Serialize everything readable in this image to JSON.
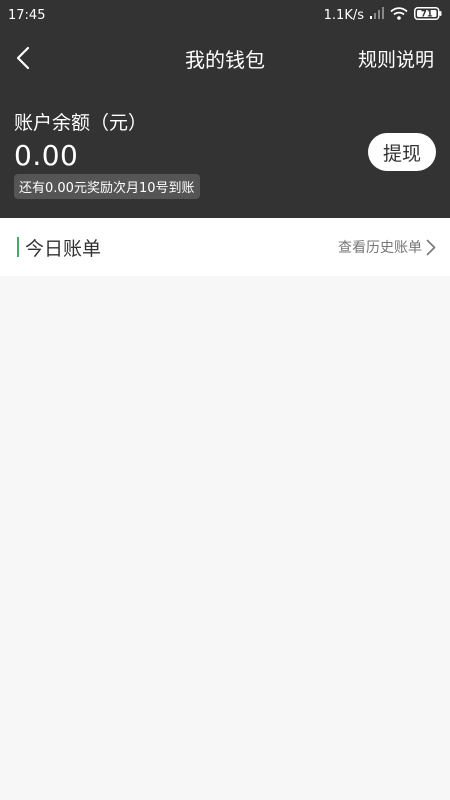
{
  "status_bar": {
    "time": "17:45",
    "network_speed": "1.1K/s",
    "battery": "71"
  },
  "nav": {
    "title": "我的钱包",
    "right_link": "规则说明"
  },
  "balance": {
    "label": "账户余额（元）",
    "amount": "0.00",
    "reward_note": "还有0.00元奖励次月10号到账",
    "withdraw_label": "提现"
  },
  "bills": {
    "title": "今日账单",
    "history_link": "查看历史账单"
  },
  "colors": {
    "header_bg": "#333333",
    "accent_green": "#3fae6b",
    "page_bg": "#f7f7f7"
  },
  "icons": {
    "back": "chevron-left-icon",
    "history": "chevron-right-icon"
  }
}
